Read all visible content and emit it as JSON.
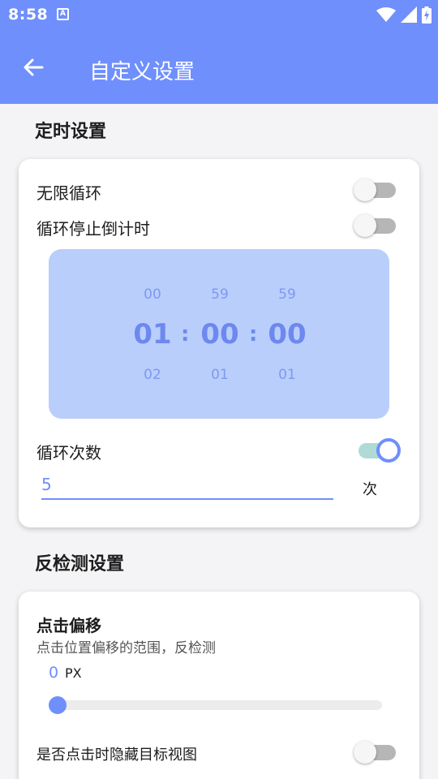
{
  "status_bar": {
    "time": "8:58",
    "notification_icon": "accessibility-a-icon",
    "icons": [
      "wifi-icon",
      "signal-icon",
      "battery-charging-icon"
    ]
  },
  "app_bar": {
    "title": "自定义设置",
    "back_icon": "arrow-left-icon"
  },
  "timer_section": {
    "title": "定时设置",
    "infinite_loop": {
      "label": "无限循环",
      "on": false
    },
    "loop_countdown": {
      "label": "循环停止倒计时",
      "on": false
    },
    "picker": {
      "hours": {
        "above": "00",
        "selected": "01",
        "below": "02"
      },
      "minutes": {
        "above": "59",
        "selected": "00",
        "below": "01"
      },
      "seconds": {
        "above": "59",
        "selected": "00",
        "below": "01"
      },
      "separator": ":"
    },
    "loop_count": {
      "label": "循环次数",
      "on": true,
      "value": "5",
      "unit": "次"
    }
  },
  "anti_detect_section": {
    "title": "反检测设置",
    "click_offset": {
      "title": "点击偏移",
      "description": "点击位置偏移的范围，反检测",
      "value": "0",
      "unit": "PX",
      "slider_fraction": 0
    },
    "hide_target_view": {
      "label": "是否点击时隐藏目标视图",
      "on": false
    }
  },
  "colors": {
    "accent": "#6f8ffd",
    "picker_bg": "#b9cefb",
    "switch_on_track": "#b0dad6",
    "switch_off_track": "#b6b6b6"
  }
}
